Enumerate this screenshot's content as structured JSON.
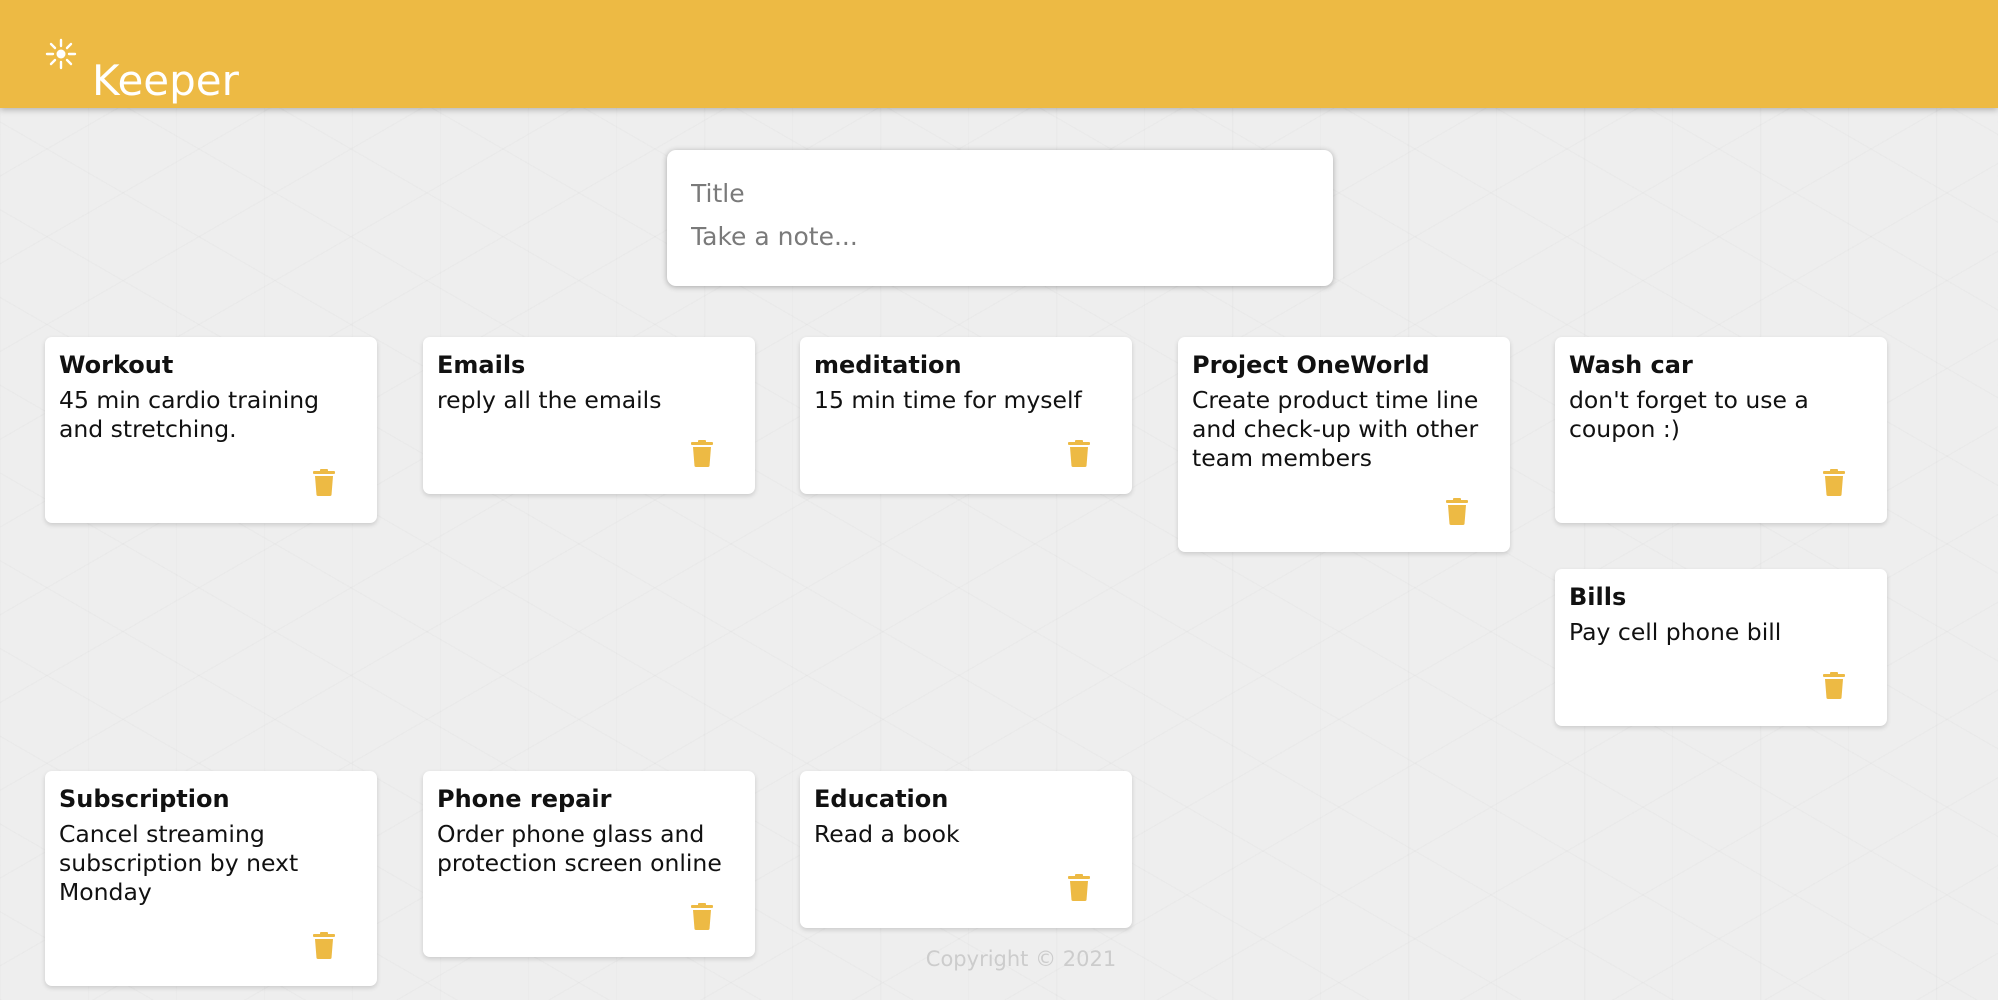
{
  "app": {
    "title": "Keeper",
    "icon": "sparkle-icon",
    "accent_color": "#EDBA44"
  },
  "create_area": {
    "title_placeholder": "Title",
    "content_placeholder": "Take a note..."
  },
  "notes": [
    {
      "title": "Workout",
      "content": "45 min cardio training and stretching."
    },
    {
      "title": "Emails",
      "content": "reply all the emails"
    },
    {
      "title": "meditation",
      "content": "15 min time for myself"
    },
    {
      "title": "Project OneWorld",
      "content": "Create product time line and check-up with other team members"
    },
    {
      "title": "Wash car",
      "content": "don't forget to use a coupon :)"
    },
    {
      "title": "Bills",
      "content": "Pay cell phone bill"
    },
    {
      "title": "Subscription",
      "content": "Cancel streaming subscription by next Monday"
    },
    {
      "title": "Phone repair",
      "content": "Order phone glass and protection screen online"
    },
    {
      "title": "Education",
      "content": "Read a book"
    }
  ],
  "delete_icon": "trash-icon",
  "footer": {
    "copyright": "Copyright © 2021"
  }
}
